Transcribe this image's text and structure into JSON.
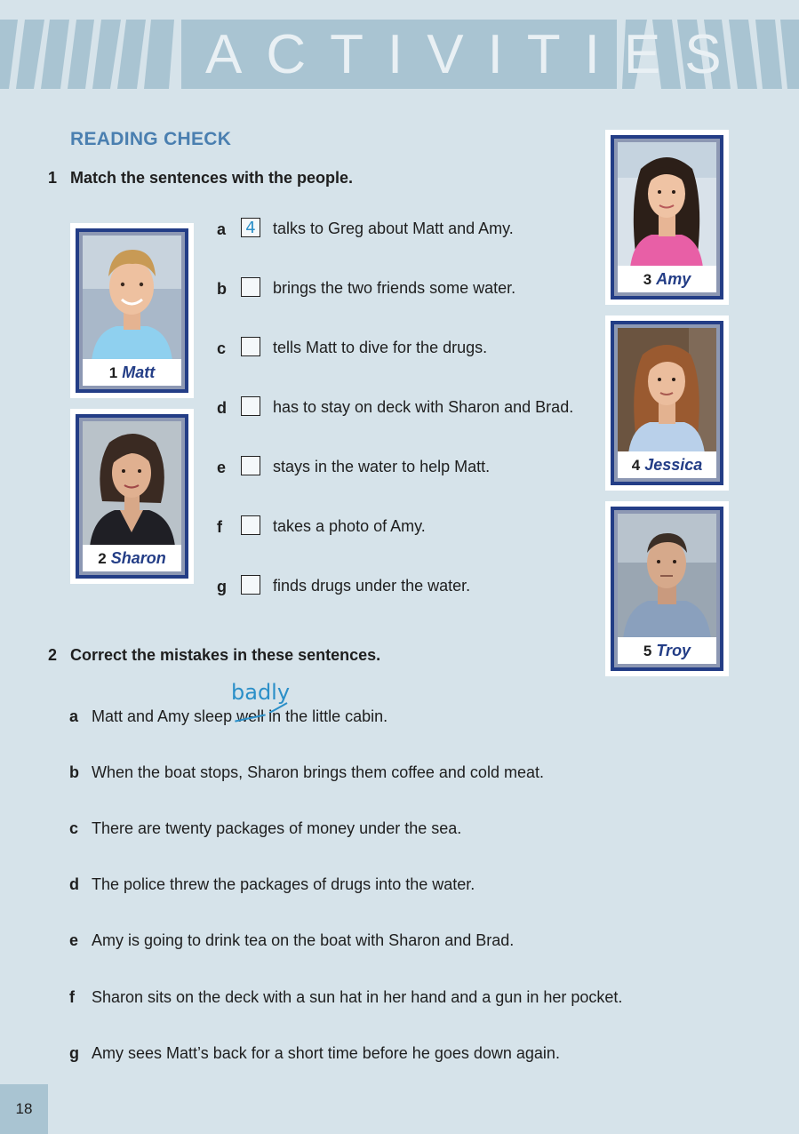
{
  "banner": {
    "title": "ACTIVITIES"
  },
  "section_title": "READING CHECK",
  "exercise1": {
    "number": "1",
    "instruction": "Match the sentences with the people.",
    "items": [
      {
        "letter": "a",
        "answer": "4",
        "text": "talks to Greg about Matt and Amy."
      },
      {
        "letter": "b",
        "answer": "",
        "text": "brings the two friends some water."
      },
      {
        "letter": "c",
        "answer": "",
        "text": "tells Matt to dive for the drugs."
      },
      {
        "letter": "d",
        "answer": "",
        "text": "has to stay on deck with Sharon and Brad."
      },
      {
        "letter": "e",
        "answer": "",
        "text": "stays in the water to help Matt."
      },
      {
        "letter": "f",
        "answer": "",
        "text": "takes a photo of Amy."
      },
      {
        "letter": "g",
        "answer": "",
        "text": "finds drugs under the water."
      }
    ]
  },
  "people": [
    {
      "number": "1",
      "name": "Matt"
    },
    {
      "number": "2",
      "name": "Sharon"
    },
    {
      "number": "3",
      "name": "Amy"
    },
    {
      "number": "4",
      "name": "Jessica"
    },
    {
      "number": "5",
      "name": "Troy"
    }
  ],
  "exercise2": {
    "number": "2",
    "instruction": "Correct the mistakes in these sentences.",
    "first_item": {
      "letter": "a",
      "before": "Matt and Amy sleep ",
      "struck": "well",
      "after": " in the little cabin.",
      "correction": "badly"
    },
    "items": [
      {
        "letter": "b",
        "text": "When the boat stops, Sharon brings them coffee and cold meat."
      },
      {
        "letter": "c",
        "text": "There are twenty packages of money under the sea."
      },
      {
        "letter": "d",
        "text": "The police threw the packages of drugs into the water."
      },
      {
        "letter": "e",
        "text": "Amy is going to drink tea on the boat with Sharon and Brad."
      },
      {
        "letter": "f",
        "text": "Sharon sits on the deck with a sun hat in her hand and a gun in her pocket."
      },
      {
        "letter": "g",
        "text": "Amy sees Matt’s back for a short time before he goes down again."
      }
    ]
  },
  "page_number": "18",
  "colors": {
    "background": "#d6e3ea",
    "banner": "#a9c4d2",
    "heading_blue": "#4a7fb0",
    "card_border": "#233d86",
    "handwriting": "#2b8fc8"
  }
}
